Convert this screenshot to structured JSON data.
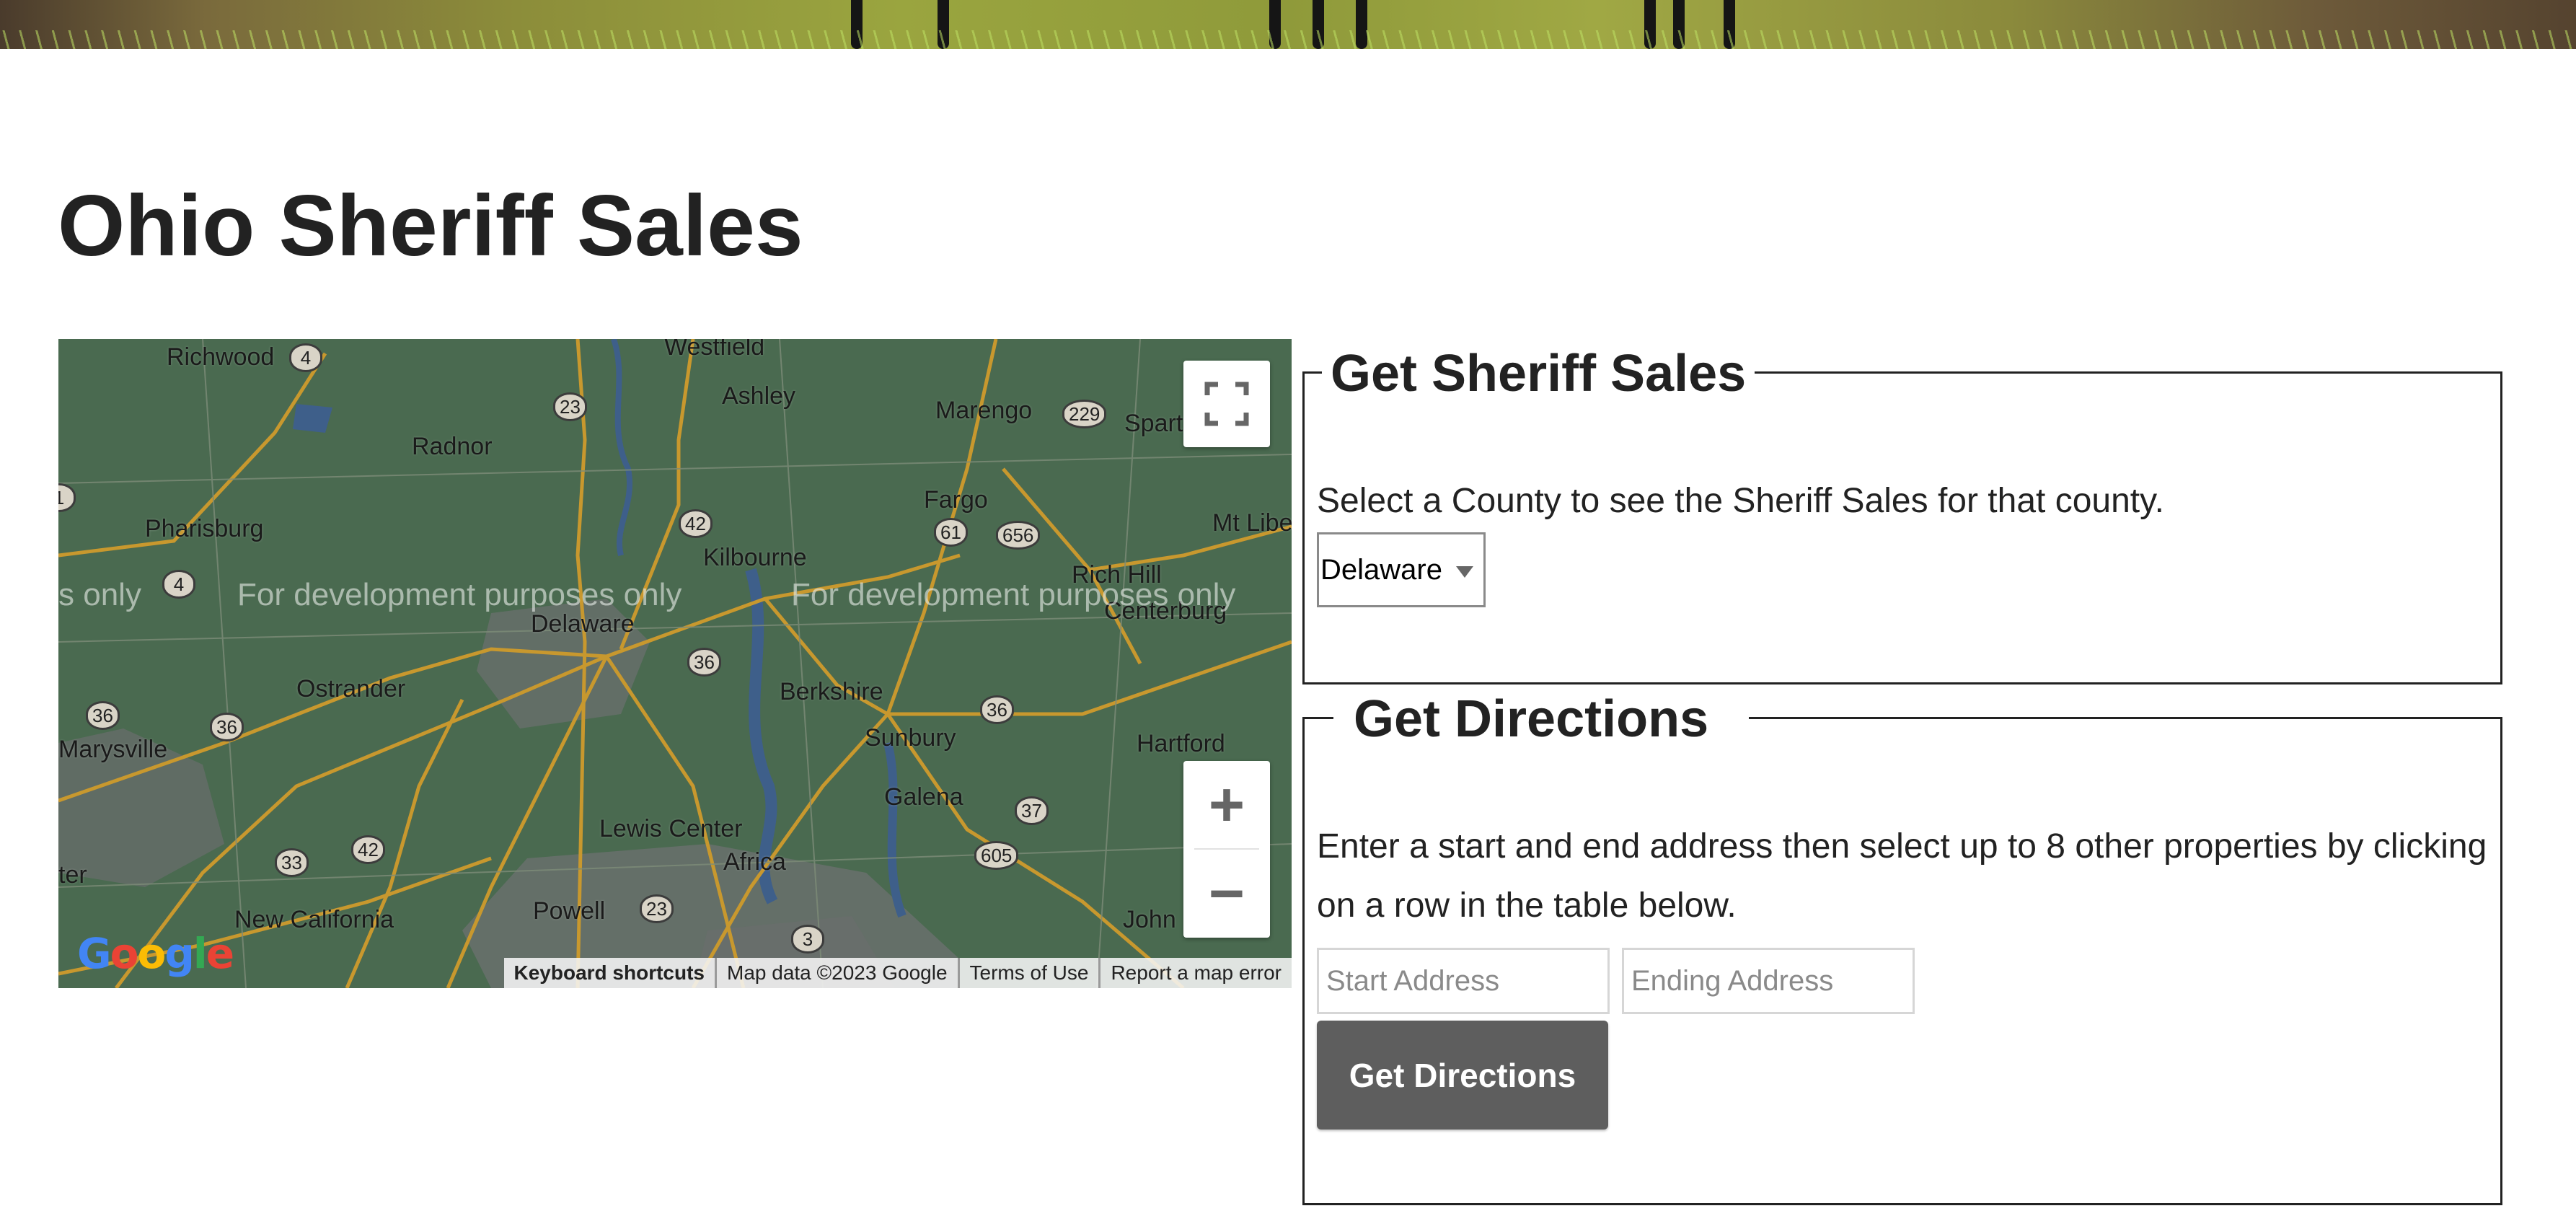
{
  "page_title": "Ohio Sheriff Sales",
  "map": {
    "labels": [
      "Richwood",
      "Westfield",
      "Ashley",
      "Marengo",
      "Spart",
      "Radnor",
      "Pharisburg",
      "Fargo",
      "Kilbourne",
      "Mt Libe",
      "Rich Hill",
      "Centerburg",
      "Delaware",
      "Ostrander",
      "Berkshire",
      "Marysville",
      "Sunbury",
      "Hartford",
      "Galena",
      "Lewis Center",
      "Africa",
      "ter",
      "New California",
      "Powell",
      "John"
    ],
    "route_shields": [
      "4",
      "23",
      "229",
      "42",
      "61",
      "656",
      "4",
      "36",
      "36",
      "36",
      "36",
      "37",
      "33",
      "42",
      "605",
      "23",
      "3",
      "1"
    ],
    "watermark": [
      "s only",
      "For development purposes only",
      "For development purposes only"
    ],
    "google_logo": "Google",
    "attribution": [
      "Keyboard shortcuts",
      "Map data ©2023 Google",
      "Terms of Use",
      "Report a map error"
    ],
    "zoom_in_label": "+",
    "zoom_out_label": "−"
  },
  "sheriff_sales": {
    "legend": "Get Sheriff Sales",
    "instruction": "Select a County to see the Sheriff Sales for that county.",
    "county_selected": "Delaware"
  },
  "directions": {
    "legend": "Get Directions",
    "instruction": "Enter a start and end address then select up to 8 other properties by clicking on a row in the table below.",
    "start_placeholder": "Start Address",
    "end_placeholder": "Ending Address",
    "button_label": "Get Directions"
  },
  "colors": {
    "map_background": "#4a6a50",
    "road": "#c8982e",
    "water": "#3e5f8a",
    "button": "#5e5e5e"
  }
}
